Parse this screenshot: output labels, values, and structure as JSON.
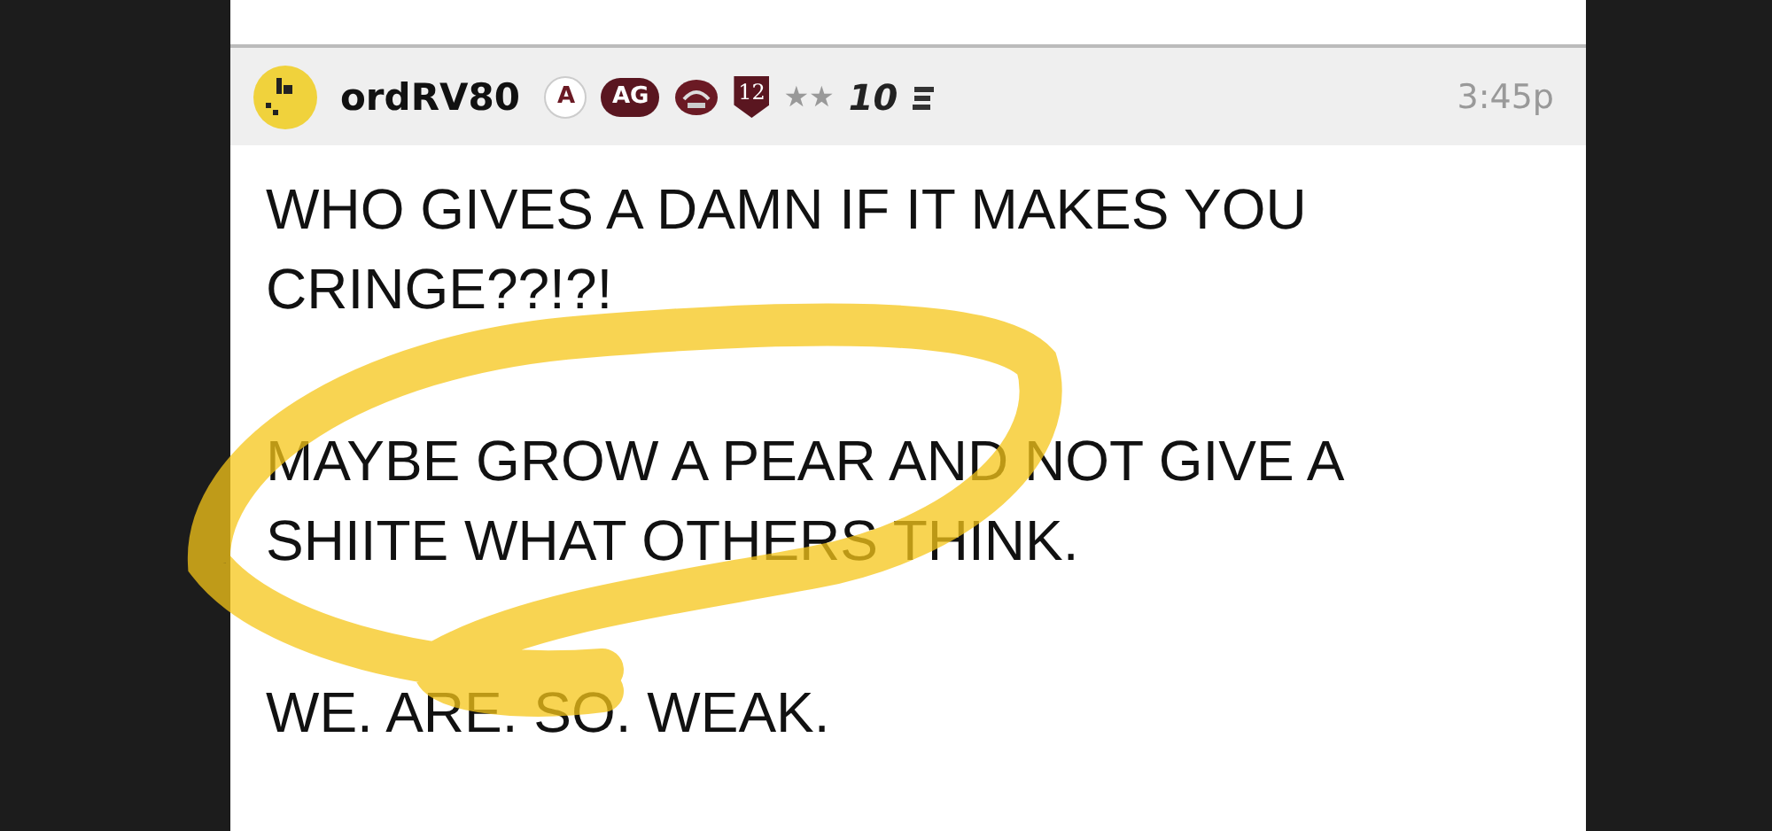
{
  "post": {
    "author": "ordRV80",
    "badges": [
      {
        "kind": "circle",
        "text": "A"
      },
      {
        "kind": "pill",
        "text": "AG"
      },
      {
        "kind": "helmet"
      },
      {
        "kind": "shield",
        "text": "12"
      }
    ],
    "rank_stars": "★★",
    "rank": "10",
    "time": "3:45p",
    "paragraphs": [
      "WHO GIVES A DAMN IF IT MAKES YOU CRINGE??!?!",
      "MAYBE GROW A PEAR AND NOT GIVE A SHIITE WHAT OTHERS THINK.",
      "WE. ARE. SO. WEAK."
    ]
  }
}
